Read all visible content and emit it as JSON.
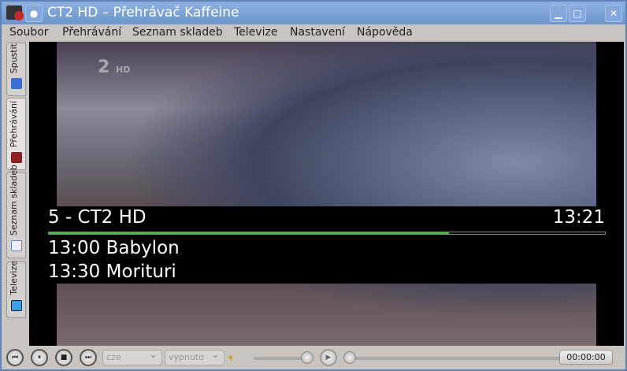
{
  "window": {
    "title": "CT2 HD – Přehrávač Kaffeine"
  },
  "menu": [
    "Soubor",
    "Přehrávání",
    "Seznam skladeb",
    "Televize",
    "Nastavení",
    "Nápověda"
  ],
  "sidebar": [
    {
      "label": "Spustit"
    },
    {
      "label": "Přehrávání"
    },
    {
      "label": "Seznam skladeb"
    },
    {
      "label": "Televize"
    }
  ],
  "video": {
    "logo": "2",
    "logo_hd": "HD"
  },
  "osd": {
    "channel": "5 - CT2 HD",
    "time": "13:21",
    "progress_percent": 72,
    "events": [
      "13:00 Babylon",
      "13:30 Morituri"
    ],
    "progress_color": "#2ec42e"
  },
  "controls": {
    "audio_lang": "cze",
    "subtitles": "vypnuto",
    "volume_percent": 100,
    "seek_percent": 0,
    "time": "00:00:00"
  }
}
